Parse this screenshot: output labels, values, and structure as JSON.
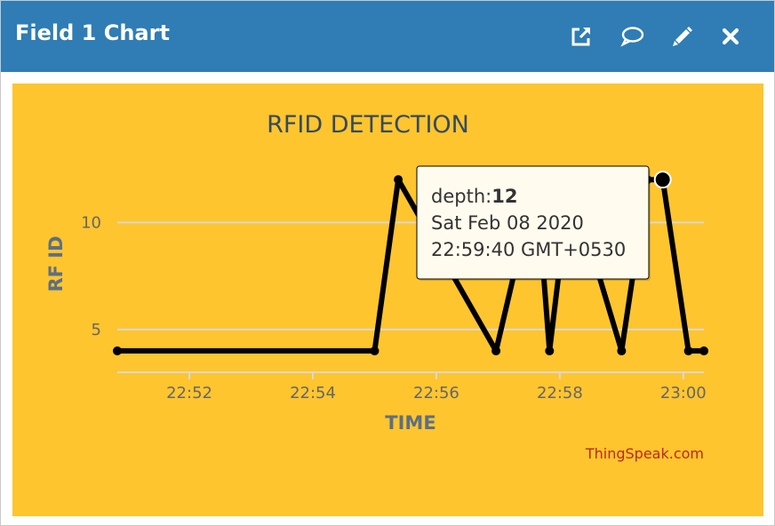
{
  "window": {
    "title": "Field 1 Chart",
    "icons": [
      "external-link-icon",
      "comment-icon",
      "pencil-icon",
      "close-icon"
    ]
  },
  "colors": {
    "header": "#2f7db4",
    "chart_background": "#fec52e",
    "series": "#000000",
    "grid": "#d8d8d8",
    "title": "#364a5d",
    "credit": "#bb2a1d"
  },
  "tooltip": {
    "label": "depth:",
    "value": "12",
    "date": "Sat Feb 08 2020",
    "time": "22:59:40 GMT+0530"
  },
  "chart_data": {
    "type": "line",
    "title": "RFID DETECTION",
    "xlabel": "TIME",
    "ylabel": "RF ID",
    "credit": "ThingSpeak.com",
    "x_ticks": [
      "22:52",
      "22:54",
      "22:56",
      "22:58",
      "23:00"
    ],
    "y_ticks": [
      5,
      10
    ],
    "grid": true,
    "legend": "none",
    "series": [
      {
        "x": [
          "22:50:50",
          "22:55:00",
          "22:55:23",
          "22:56:58",
          "22:57:37",
          "22:57:50",
          "22:58:10",
          "22:59:00",
          "22:59:25",
          "22:59:40",
          "23:00:05",
          "23:00:20"
        ],
        "values": [
          4,
          4,
          12,
          4,
          12,
          4,
          12,
          4,
          12,
          12,
          4,
          4
        ]
      }
    ],
    "highlighted_point_index": 9
  }
}
